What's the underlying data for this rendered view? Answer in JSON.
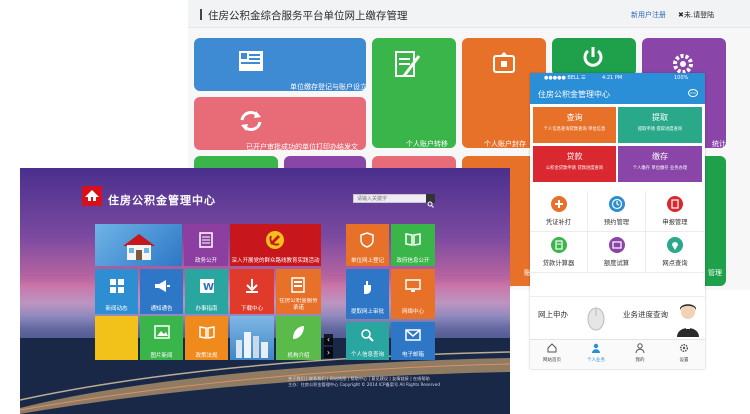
{
  "portal": {
    "title": "住房公积金综合服务平台单位网上缴存管理",
    "register": "新用户注册",
    "login": "✖未.请登陆",
    "tiles": [
      {
        "label": "单位缴存登记与账户设立",
        "color": "#3f8bd3",
        "icon": "card-icon"
      },
      {
        "label": "",
        "color": "#3ab54a",
        "icon": "edit-document-icon"
      },
      {
        "label": "",
        "color": "#e8712a",
        "icon": "tray-icon"
      },
      {
        "label": "",
        "color": "#1fa04a",
        "icon": "power-icon"
      },
      {
        "label": "",
        "color": "#8a45a8",
        "icon": "gear-icon"
      },
      {
        "label": "已开户审批成功的单位打印办结发文",
        "color": "#e86c78",
        "icon": "refresh-icon"
      },
      {
        "label": "个人账户转移",
        "color": "#2f9a4b",
        "icon": ""
      },
      {
        "label": "个人账户封存",
        "color": "#d88a23",
        "icon": ""
      },
      {
        "label": "统计",
        "color": "#8a45a8",
        "icon": ""
      },
      {
        "label": "账户",
        "color": "#e8712a",
        "icon": ""
      },
      {
        "label": "管理",
        "color": "#1fa04a",
        "icon": ""
      }
    ]
  },
  "center": {
    "logo_text": "住房",
    "title": "住房公积金管理中心",
    "search_placeholder": "请输入关键字",
    "tiles": [
      {
        "label": "",
        "color": "#2d77c6",
        "icon": "house-image"
      },
      {
        "label": "政务公开",
        "color": "#8c3ea1",
        "icon": "document-icon"
      },
      {
        "label": "深入开展党的群众路线教育实践活动",
        "color": "#c8161d",
        "icon": "party-emblem-icon"
      },
      {
        "label": "新闻动态",
        "color": "#2d8fd2",
        "icon": "grid-icon"
      },
      {
        "label": "通知通告",
        "color": "#2d77c6",
        "icon": "megaphone-icon"
      },
      {
        "label": "办事指南",
        "color": "#2aa6a0",
        "icon": "word-doc-icon"
      },
      {
        "label": "下载中心",
        "color": "#e03a2a",
        "icon": "download-icon"
      },
      {
        "label": "住房公积金服务承诺",
        "color": "#e8712a",
        "icon": "document-list-icon"
      },
      {
        "label": "",
        "color": "#f2c21a",
        "icon": ""
      },
      {
        "label": "图片新闻",
        "color": "#3ab54a",
        "icon": "picture-icon"
      },
      {
        "label": "政策法规",
        "color": "#f08a1c",
        "icon": "book-icon"
      },
      {
        "label": "",
        "color": "#3f87c7",
        "icon": "city-image"
      },
      {
        "label": "机构介绍",
        "color": "#5aba4a",
        "icon": "leaf-icon"
      },
      {
        "label": "单位网上登记",
        "color": "#e8712a",
        "icon": "shield-icon"
      },
      {
        "label": "政府信息公开",
        "color": "#3ab54a",
        "icon": "book-icon"
      },
      {
        "label": "提取网上审批",
        "color": "#2d77c6",
        "icon": "hand-icon"
      },
      {
        "label": "网络中心",
        "color": "#e8712a",
        "icon": "monitor-icon"
      },
      {
        "label": "个人信息查询",
        "color": "#2aa6a0",
        "icon": "magnifier-icon"
      },
      {
        "label": "电子邮箱",
        "color": "#2d77c6",
        "icon": "mail-icon"
      }
    ],
    "footer_line1": "关于我们 | 联系我们 | 网站地图 | 帮助中心 | 意见建议 | 友情链接 | 在线帮助",
    "footer_line2": "主办：住房公积金管理中心  Copyright © 2014  ICP备案号  All Rights Reserved"
  },
  "phone": {
    "carrier": "●●●●● BELL ☰",
    "time": "4:21 PM",
    "battery": "100%",
    "app_title": "住房公积金管理中心",
    "tiles": [
      {
        "title": "查询",
        "sub": "个人信息查询贷款查询 单位信息",
        "color": "#e8712a"
      },
      {
        "title": "提取",
        "sub": "提取申请 提取进度查询",
        "color": "#2aa98a"
      },
      {
        "title": "贷款",
        "sub": "公积金贷款申请 贷款进度查询",
        "color": "#d9282f"
      },
      {
        "title": "缴存",
        "sub": "个人缴存 单位缴存 业务办理",
        "color": "#8a45a8"
      }
    ],
    "services": [
      {
        "label": "凭证补打",
        "color": "#e8712a"
      },
      {
        "label": "预约管理",
        "color": "#2d8fd2"
      },
      {
        "label": "申报管理",
        "color": "#d9282f"
      },
      {
        "label": "贷款计算器",
        "color": "#3ab54a"
      },
      {
        "label": "额度试算",
        "color": "#8a45a8"
      },
      {
        "label": "网点查询",
        "color": "#2aa98a"
      }
    ],
    "banner_online": "网上申办",
    "banner_progress": "业务进度查询",
    "nav": [
      {
        "label": "网站首页"
      },
      {
        "label": "个人业务"
      },
      {
        "label": "我的"
      },
      {
        "label": "设置"
      }
    ]
  }
}
